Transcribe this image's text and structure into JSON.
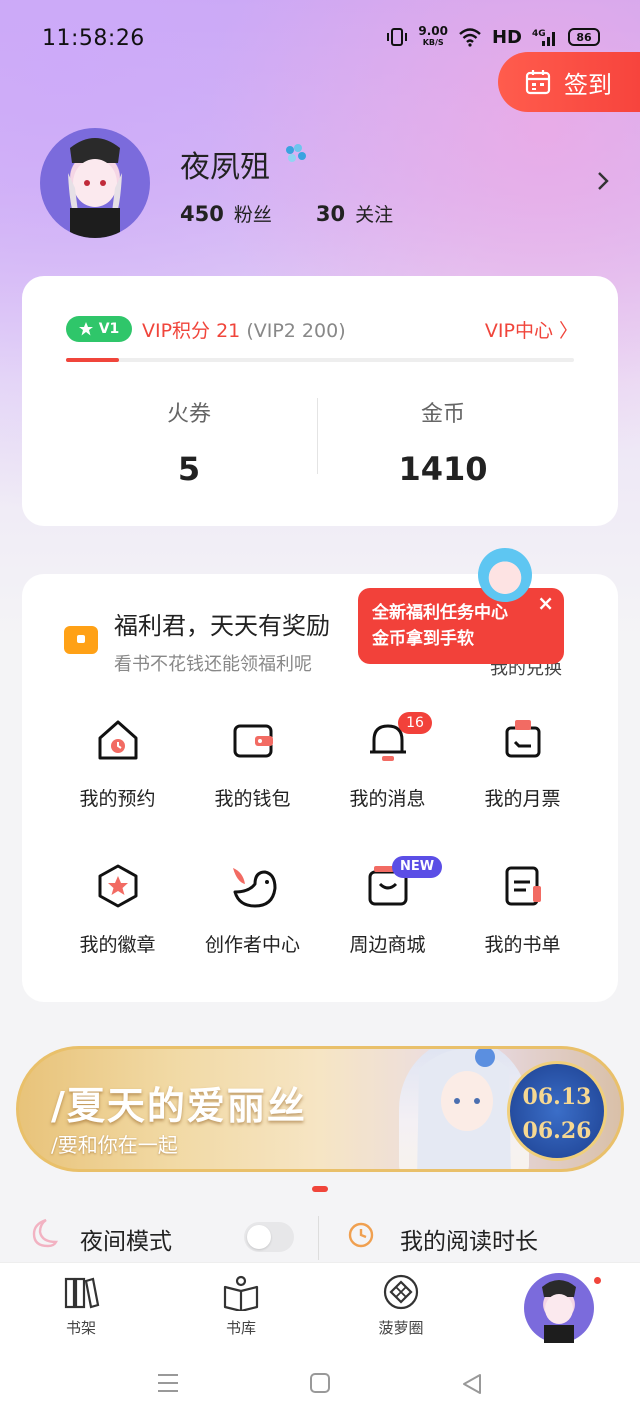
{
  "status_bar": {
    "time": "11:58:26",
    "net_speed_value": "9.00",
    "net_speed_unit": "KB/S",
    "hd": "HD",
    "network": "4G",
    "battery": "86"
  },
  "checkin": {
    "label": "签到"
  },
  "profile": {
    "name": "夜夙殂",
    "fans_count": "450",
    "fans_label": "粉丝",
    "follow_count": "30",
    "follow_label": "关注"
  },
  "vip": {
    "level_badge": "V1",
    "points_text": "VIP积分 21",
    "next_level_text": "(VIP2 200)",
    "center_label": "VIP中心 〉",
    "progress": 0.105
  },
  "assets": {
    "tickets_label": "火券",
    "tickets_value": "5",
    "coins_label": "金币",
    "coins_value": "1410"
  },
  "welfare": {
    "title": "福利君，天天有奖励",
    "subtitle": "看书不花钱还能领福利呢",
    "link": "我的兑换",
    "popup_line1": "全新福利任务中心",
    "popup_line2": "金币拿到手软",
    "popup_close": "×"
  },
  "menu": {
    "items": [
      {
        "label": "我的预约"
      },
      {
        "label": "我的钱包"
      },
      {
        "label": "我的消息",
        "badge": "16"
      },
      {
        "label": "我的月票"
      },
      {
        "label": "我的徽章"
      },
      {
        "label": "创作者中心"
      },
      {
        "label": "周边商城",
        "badge": "NEW"
      },
      {
        "label": "我的书单"
      }
    ]
  },
  "banner": {
    "title": "/夏天的爱丽丝",
    "subtitle": "/要和你在一起",
    "date_start": "06.13",
    "date_end": "06.26"
  },
  "quick": {
    "night_mode_label": "夜间模式",
    "night_mode_on": false,
    "reading_time_label": "我的阅读时长"
  },
  "tabs": [
    {
      "label": "书架"
    },
    {
      "label": "书库"
    },
    {
      "label": "菠萝圈"
    }
  ],
  "colors": {
    "accent": "#f0453b",
    "vip_green": "#2fc66a",
    "new_badge": "#5b4ee6",
    "welfare_orange": "#ffa116"
  }
}
